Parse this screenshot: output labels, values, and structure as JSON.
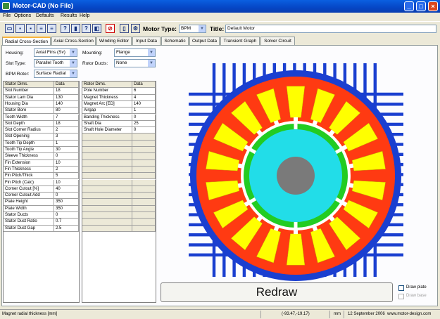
{
  "window": {
    "title": "Motor-CAD (No File)"
  },
  "menu": [
    "File",
    "Options",
    "Defaults",
    "Results",
    "Help"
  ],
  "toolbar": {
    "motor_type_label": "Motor Type:",
    "motor_type_value": "BPM",
    "title_label": "Title:",
    "title_value": "Default Motor"
  },
  "tabs": [
    "Radial Cross-Section",
    "Axial Cross-Section",
    "Winding Editor",
    "Input Data",
    "Schematic",
    "Output Data",
    "Transient Graph",
    "Solver Circuit"
  ],
  "options": {
    "housing_label": "Housing:",
    "housing_value": "Axial Fins (Sv)",
    "slot_type_label": "Slot Type:",
    "slot_type_value": "Parallel Tooth",
    "bpm_rotor_label": "BPM Rotor:",
    "bpm_rotor_value": "Surface Radial",
    "mounting_label": "Mounting:",
    "mounting_value": "Flange",
    "rotor_ducts_label": "Rotor Ducts:",
    "rotor_ducts_value": "None"
  },
  "stator_table": {
    "headers": [
      "Stator Dims.",
      "Data"
    ],
    "rows": [
      [
        "Slot Number",
        "18"
      ],
      [
        "Stator Lam Dia",
        "130"
      ],
      [
        "Housing Dia",
        "140"
      ],
      [
        "Stator Bore",
        "80"
      ],
      [
        "Tooth Width",
        "7"
      ],
      [
        "Slot Depth",
        "18"
      ],
      [
        "Slot Corner Radius",
        "2"
      ],
      [
        "Slot Opening",
        "3"
      ],
      [
        "Tooth Tip Depth",
        "1"
      ],
      [
        "Tooth Tip Angle",
        "30"
      ],
      [
        "Sleeve Thickness",
        "0"
      ],
      [
        "Fin Extension",
        "10"
      ],
      [
        "Fin Thickness",
        "2"
      ],
      [
        "Fin Pitch/Thick",
        "5"
      ],
      [
        "Fin Pitch (Calc)",
        "10"
      ],
      [
        "Corner Cutout [%]",
        "40"
      ],
      [
        "Corner Cutout Add",
        "0"
      ],
      [
        "Plate Height",
        "350"
      ],
      [
        "Plate Width",
        "350"
      ],
      [
        "Stator Ducts",
        "0"
      ],
      [
        "Stator Duct Ratio",
        "0.7"
      ],
      [
        "Stator Duct Gap",
        "2.5"
      ]
    ]
  },
  "rotor_table": {
    "headers": [
      "Rotor Dims.",
      "Data"
    ],
    "rows": [
      [
        "Pole Number",
        "6"
      ],
      [
        "Magnet Thickness",
        "4"
      ],
      [
        "Magnet Arc [ED]",
        "140"
      ],
      [
        "Airgap",
        "1"
      ],
      [
        "Banding Thickness",
        "0"
      ],
      [
        "Shaft Dia",
        "25"
      ],
      [
        "Shaft Hole Diameter",
        "0"
      ]
    ]
  },
  "redraw_label": "Redraw",
  "draw_plate_label": "Draw plate",
  "draw_base_label": "Draw base",
  "status": {
    "hint": "Magnet radial thickness [mm]",
    "coords": "(-93.47,-19.17)",
    "unit": "mm",
    "date": "12 September 2006",
    "website": "www.motor-design.com"
  },
  "colors": {
    "housing": "#1a3fd0",
    "stator": "#ff3a12",
    "slot_fill": "#ffff00",
    "tooth_tip_gap": "#ffffff",
    "magnet": "#22cc22",
    "rotor": "#22dde8",
    "shaft": "#7a7a7a"
  }
}
